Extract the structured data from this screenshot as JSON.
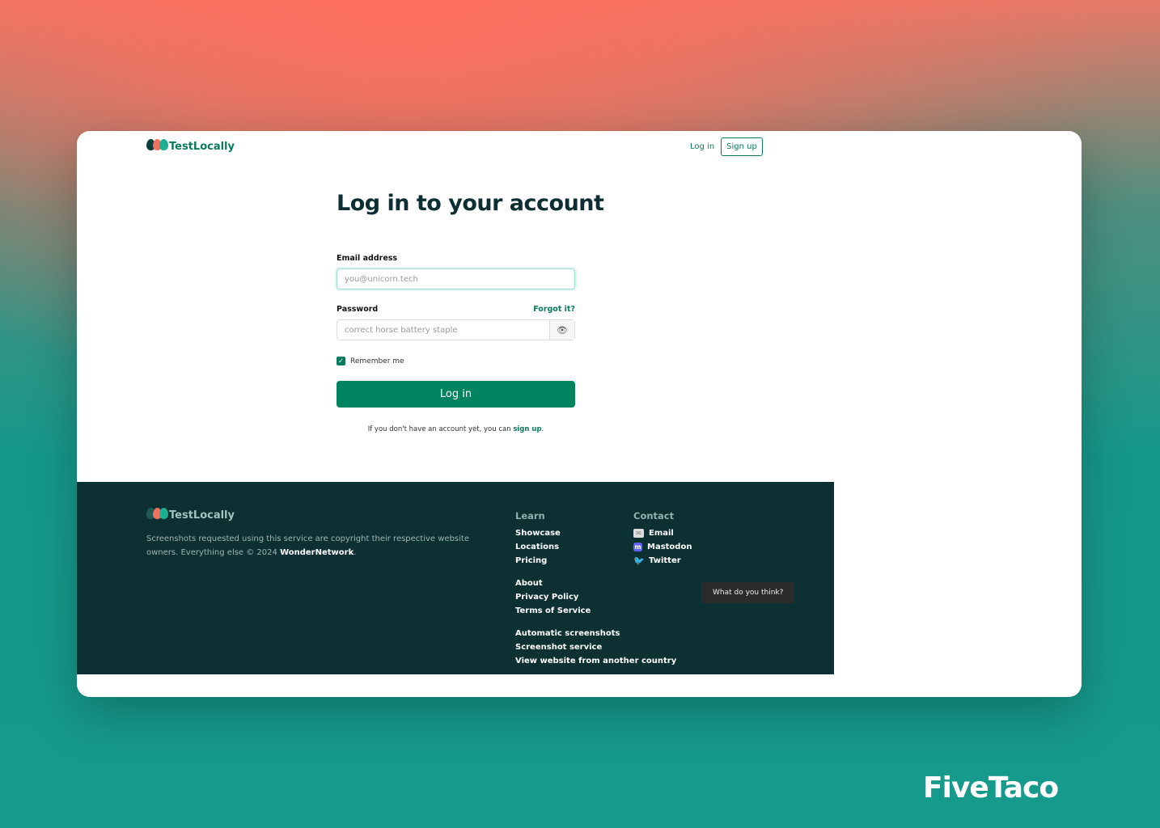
{
  "header": {
    "brand": "TestLocally",
    "login": "Log in",
    "signup": "Sign up"
  },
  "main": {
    "title": "Log in to your account",
    "email_label": "Email address",
    "email_placeholder": "you@unicorn.tech",
    "password_label": "Password",
    "forgot": "Forgot it?",
    "password_placeholder": "correct horse battery staple",
    "remember": "Remember me",
    "remember_checked": true,
    "submit": "Log in",
    "note_prefix": "If you don't have an account yet, you can ",
    "note_link": "sign up",
    "note_suffix": "."
  },
  "footer": {
    "brand": "TestLocally",
    "copy_text": "Screenshots requested using this service are copyright their respective website owners. Everything else © 2024 ",
    "copy_owner": "WonderNetwork",
    "copy_end": ".",
    "learn_title": "Learn",
    "learn": [
      [
        "Showcase",
        "Locations",
        "Pricing"
      ],
      [
        "About",
        "Privacy Policy",
        "Terms of Service"
      ],
      [
        "Automatic screenshots",
        "Screenshot service",
        "View website from another country"
      ]
    ],
    "contact_title": "Contact",
    "contact": [
      "Email",
      "Mastodon",
      "Twitter"
    ],
    "feedback": "What do you think?"
  },
  "watermark": "FiveTaco",
  "colors": {
    "accent": "#00835f",
    "footer_bg": "#0d3033"
  }
}
